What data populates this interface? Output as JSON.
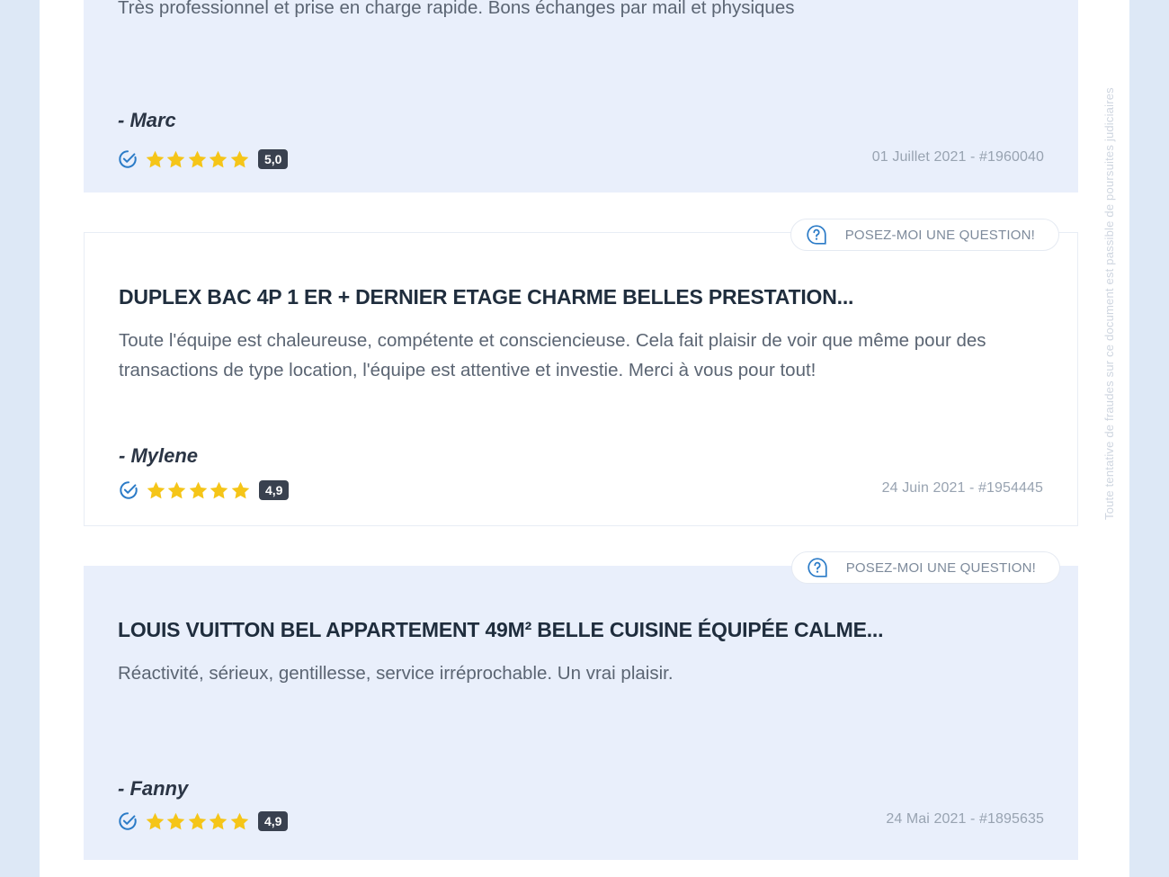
{
  "side_note": "Toute tentative de fraudes sur ce document est passible de poursuites judiciaires",
  "question_label": "POSEZ-MOI UNE QUESTION!",
  "colors": {
    "star": "#f5c518",
    "check": "#2b7bc7",
    "badge": "#39414f",
    "shaded_card": "#e9effb"
  },
  "icons": {
    "question": "question-bubble-icon",
    "verified": "verified-check-icon",
    "star": "star-icon"
  },
  "reviews": [
    {
      "text": "Très professionnel et prise en charge rapide. Bons échanges par mail et physiques",
      "author": "- Marc",
      "stars": 5,
      "score": "5,0",
      "meta": "01 Juillet 2021 - #1960040"
    },
    {
      "title": "DUPLEX BAC 4P 1 ER + DERNIER ETAGE CHARME BELLES PRESTATION...",
      "text": "Toute l'équipe est chaleureuse, compétente et consciencieuse. Cela fait plaisir de voir que même pour des transactions de type location, l'équipe est attentive et investie. Merci à vous pour tout!",
      "author": "- Mylene",
      "stars": 5,
      "score": "4,9",
      "meta": "24 Juin 2021 - #1954445"
    },
    {
      "title": "LOUIS VUITTON BEL APPARTEMENT 49M² BELLE CUISINE ÉQUIPÉE CALME...",
      "text": "Réactivité, sérieux, gentillesse, service irréprochable. Un vrai plaisir.",
      "author": "- Fanny",
      "stars": 5,
      "score": "4,9",
      "meta": "24 Mai 2021 - #1895635"
    }
  ]
}
